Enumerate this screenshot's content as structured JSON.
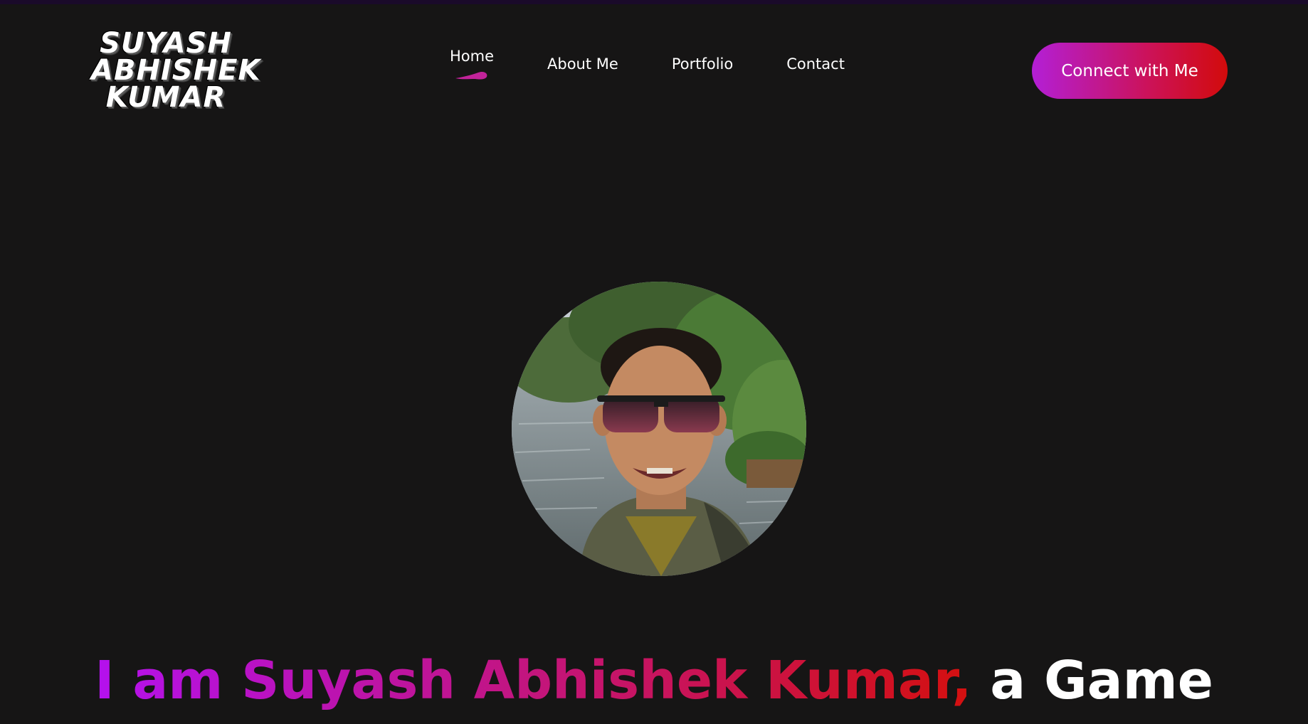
{
  "brand": {
    "logo_lines": [
      "SUYASH",
      "ABHISHEK",
      "KUMAR"
    ]
  },
  "nav": {
    "items": [
      {
        "label": "Home",
        "active": true
      },
      {
        "label": "About Me",
        "active": false
      },
      {
        "label": "Portfolio",
        "active": false
      },
      {
        "label": "Contact",
        "active": false
      }
    ]
  },
  "cta": {
    "label": "Connect with Me"
  },
  "hero": {
    "headline_gradient": "I am Suyash Abhishek Kumar,",
    "headline_rest": " a Game"
  },
  "colors": {
    "background": "#161515",
    "accent_purple": "#b31fd6",
    "accent_red": "#d20b0b",
    "nav_indicator": "#c2239a"
  },
  "icons": {
    "active_indicator": "swoosh-indicator-icon"
  }
}
